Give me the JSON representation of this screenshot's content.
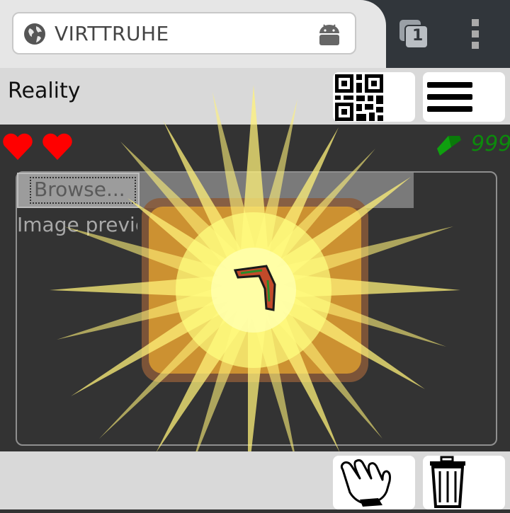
{
  "browser": {
    "url": "VIRTTRUHE",
    "tab_count": "1",
    "icons": {
      "site": "globe-icon",
      "app": "android-icon",
      "tabs": "tabs-icon",
      "menu": "kebab-menu-icon"
    }
  },
  "header": {
    "title": "Reality",
    "icons": {
      "qr": "qr-code-icon",
      "menu": "hamburger-menu-icon"
    }
  },
  "status": {
    "hearts": 2,
    "heart_color": "#ff0000",
    "currency_icon": "green-gem-icon",
    "currency_value": "999",
    "currency_color": "#0c8a0c"
  },
  "upload": {
    "browse_label": "Browse...",
    "preview_text": "Image preview"
  },
  "scene": {
    "object": "boomerang",
    "effect": "yellow-starburst",
    "effect_color": "#fff27a"
  },
  "bottom": {
    "icons": {
      "grab": "grab-hand-icon",
      "delete": "trash-icon"
    }
  }
}
